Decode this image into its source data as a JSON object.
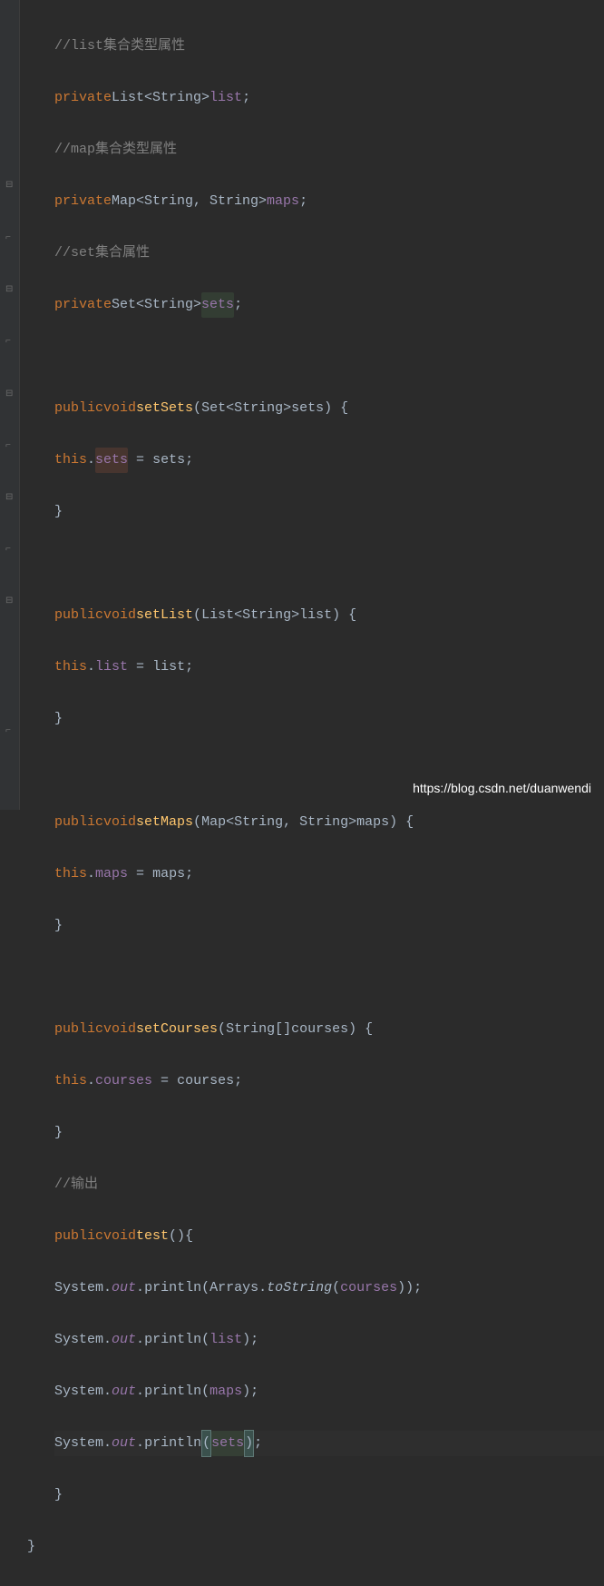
{
  "code": {
    "comment_list": "//list集合类型属性",
    "decl_list_private": "private",
    "decl_list_type": "List<String>",
    "decl_list_name": "list",
    "comment_map": "//map集合类型属性",
    "decl_map_private": "private",
    "decl_map_type": "Map<String, String>",
    "decl_map_name": "maps",
    "comment_set": "//set集合属性",
    "decl_set_private": "private",
    "decl_set_type": "Set<String>",
    "decl_set_name": "sets",
    "setSets_sig_public": "public",
    "setSets_sig_void": "void",
    "setSets_name": "setSets",
    "setSets_param_type": "Set<String>",
    "setSets_param_name": "sets",
    "setSets_this": "this",
    "setSets_field": "sets",
    "setSets_assign": "sets",
    "setList_sig_public": "public",
    "setList_sig_void": "void",
    "setList_name": "setList",
    "setList_param_type": "List<String>",
    "setList_param_name": "list",
    "setList_this": "this",
    "setList_field": "list",
    "setList_assign": "list",
    "setMaps_sig_public": "public",
    "setMaps_sig_void": "void",
    "setMaps_name": "setMaps",
    "setMaps_param_type": "Map<String, String>",
    "setMaps_param_name": "maps",
    "setMaps_this": "this",
    "setMaps_field": "maps",
    "setMaps_assign": "maps",
    "setCourses_sig_public": "public",
    "setCourses_sig_void": "void",
    "setCourses_name": "setCourses",
    "setCourses_param_type": "String[]",
    "setCourses_param_name": "courses",
    "setCourses_this": "this",
    "setCourses_field": "courses",
    "setCourses_assign": "courses",
    "comment_output": "//输出",
    "test_public": "public",
    "test_void": "void",
    "test_name": "test",
    "sys": "System",
    "out": "out",
    "println": "println",
    "arrays": "Arrays",
    "toString": "toString",
    "courses_arg": "courses",
    "list_arg": "list",
    "maps_arg": "maps",
    "sets_arg": "sets"
  },
  "watermark": "https://blog.csdn.net/duanwendi",
  "gutter_icons": {
    "collapse": "⊟",
    "expand_end": "⌐"
  }
}
